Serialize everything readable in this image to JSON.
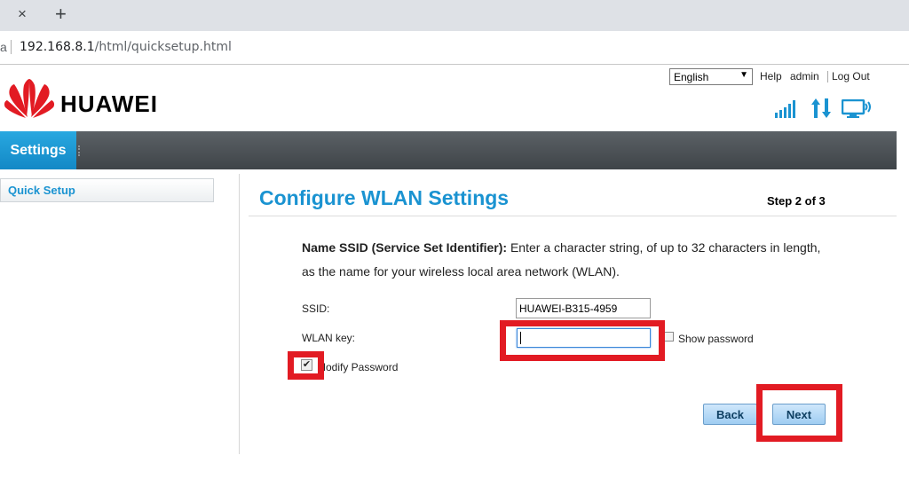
{
  "browser": {
    "tab_close": "×",
    "new_tab": "+",
    "url_host": "192.168.8.1",
    "url_path": "/html/quicksetup.html"
  },
  "header": {
    "language": "English",
    "help": "Help",
    "admin": "admin",
    "logout": "Log Out",
    "brand": "HUAWEI",
    "brand_color": "#e21b23",
    "status_icons": [
      "signal-icon",
      "data-transfer-icon",
      "monitor-icon"
    ]
  },
  "nav": {
    "settings": "Settings"
  },
  "sidebar": {
    "items": [
      {
        "label": "Quick Setup"
      }
    ]
  },
  "main": {
    "title": "Configure WLAN Settings",
    "step": "Step 2 of 3",
    "desc_bold": "Name SSID (Service Set Identifier):",
    "desc_rest": " Enter a character string, of up to 32 characters in length, as the name for your wireless local area network (WLAN).",
    "ssid_label": "SSID:",
    "ssid_value": "HUAWEI-B315-4959",
    "wlan_key_label": "WLAN key:",
    "wlan_key_value": "",
    "show_password": "Show password",
    "modify_password": "Modify Password",
    "back": "Back",
    "next": "Next",
    "accent_color": "#1a93d1",
    "highlight_color": "#e21b23"
  }
}
